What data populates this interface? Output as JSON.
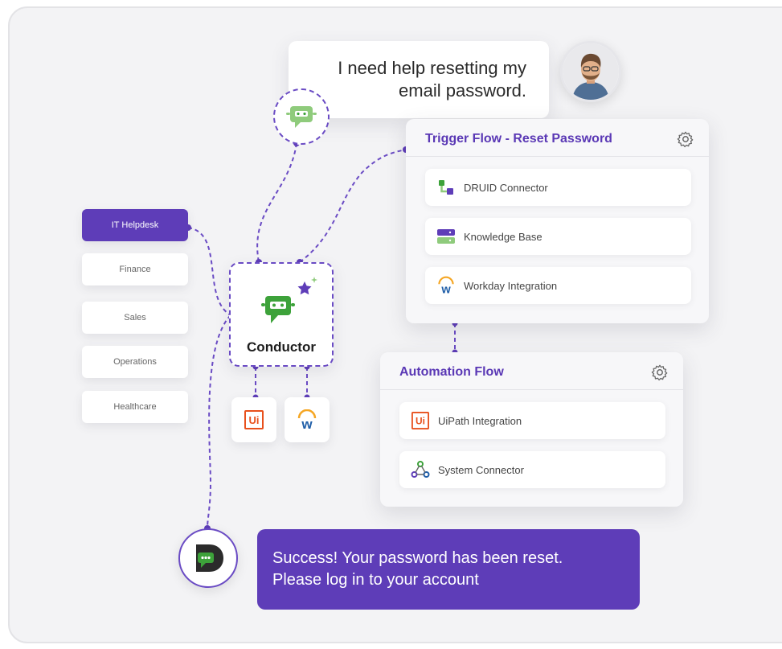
{
  "user_message": {
    "line1": "I need help resetting my",
    "line2": "email password."
  },
  "conductor": {
    "label": "Conductor"
  },
  "departments": [
    {
      "label": "IT Helpdesk",
      "active": true
    },
    {
      "label": "Finance",
      "active": false
    },
    {
      "label": "Sales",
      "active": false
    },
    {
      "label": "Operations",
      "active": false
    },
    {
      "label": "Healthcare",
      "active": false
    }
  ],
  "trigger_flow": {
    "title": "Trigger Flow - Reset Password",
    "items": [
      {
        "label": "DRUID Connector",
        "icon": "druid-connector-icon"
      },
      {
        "label": "Knowledge Base",
        "icon": "knowledge-base-icon"
      },
      {
        "label": "Workday Integration",
        "icon": "workday-icon"
      }
    ]
  },
  "automation_flow": {
    "title": "Automation Flow",
    "items": [
      {
        "label": "UiPath Integration",
        "icon": "uipath-icon",
        "badge": "Ui"
      },
      {
        "label": "System Connector",
        "icon": "system-connector-icon"
      }
    ]
  },
  "mini_tiles": {
    "uipath_badge": "Ui",
    "workday_letter": "w"
  },
  "success_message": {
    "line1": "Success! Your password has been reset.",
    "line2": "Please log in to your account"
  },
  "colors": {
    "accent": "#5e3db8",
    "bot_green": "#3da23a",
    "uipath_orange": "#e8501c",
    "workday_blue": "#1f5ea8",
    "workday_orange": "#f5a623"
  }
}
